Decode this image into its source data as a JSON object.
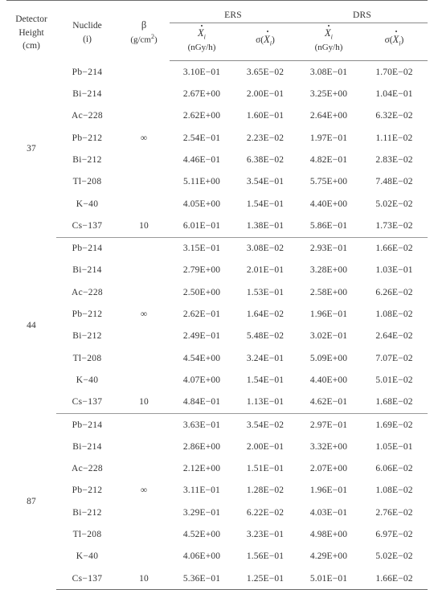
{
  "table": {
    "headers": {
      "detector_height": [
        "Detector",
        "Height",
        "(cm)"
      ],
      "nuclide": [
        "Nuclide",
        "(i)"
      ],
      "group_ers": "ERS",
      "group_drs": "DRS",
      "beta_symbol": "β",
      "beta_unit": "(g/cm",
      "beta_unit_sup": "2",
      "beta_unit_close": ")",
      "dose_symbol": "X",
      "dose_sub": "i",
      "dose_unit": "(nGy/h)",
      "sigma_open": "σ(",
      "sigma_symbol": "X",
      "sigma_sub": "i",
      "sigma_close": ")"
    },
    "columns": [
      "Detector Height (cm)",
      "Nuclide (i)",
      "β (g/cm2)",
      "ERS Ẋi (nGy/h)",
      "ERS σ(Ẋi)",
      "DRS Ẋi (nGy/h)",
      "DRS σ(Ẋi)"
    ],
    "blocks": [
      {
        "detector_height": "37",
        "rows": [
          {
            "nuclide": "Pb−214",
            "beta": "",
            "ers_x": "3.10E−01",
            "ers_sigma": "3.65E−02",
            "drs_x": "3.08E−01",
            "drs_sigma": "1.70E−02"
          },
          {
            "nuclide": "Bi−214",
            "beta": "",
            "ers_x": "2.67E+00",
            "ers_sigma": "2.00E−01",
            "drs_x": "3.25E+00",
            "drs_sigma": "1.04E−01"
          },
          {
            "nuclide": "Ac−228",
            "beta": "",
            "ers_x": "2.62E+00",
            "ers_sigma": "1.60E−01",
            "drs_x": "2.64E+00",
            "drs_sigma": "6.32E−02"
          },
          {
            "nuclide": "Pb−212",
            "beta": "∞",
            "ers_x": "2.54E−01",
            "ers_sigma": "2.23E−02",
            "drs_x": "1.97E−01",
            "drs_sigma": "1.11E−02"
          },
          {
            "nuclide": "Bi−212",
            "beta": "",
            "ers_x": "4.46E−01",
            "ers_sigma": "6.38E−02",
            "drs_x": "4.82E−01",
            "drs_sigma": "2.83E−02"
          },
          {
            "nuclide": "Tl−208",
            "beta": "",
            "ers_x": "5.11E+00",
            "ers_sigma": "3.54E−01",
            "drs_x": "5.75E+00",
            "drs_sigma": "7.48E−02"
          },
          {
            "nuclide": "K−40",
            "beta": "",
            "ers_x": "4.05E+00",
            "ers_sigma": "1.54E−01",
            "drs_x": "4.40E+00",
            "drs_sigma": "5.02E−02"
          },
          {
            "nuclide": "Cs−137",
            "beta": "10",
            "ers_x": "6.01E−01",
            "ers_sigma": "1.38E−01",
            "drs_x": "5.86E−01",
            "drs_sigma": "1.73E−02"
          }
        ]
      },
      {
        "detector_height": "44",
        "rows": [
          {
            "nuclide": "Pb−214",
            "beta": "",
            "ers_x": "3.15E−01",
            "ers_sigma": "3.08E−02",
            "drs_x": "2.93E−01",
            "drs_sigma": "1.66E−02"
          },
          {
            "nuclide": "Bi−214",
            "beta": "",
            "ers_x": "2.79E+00",
            "ers_sigma": "2.01E−01",
            "drs_x": "3.28E+00",
            "drs_sigma": "1.03E−01"
          },
          {
            "nuclide": "Ac−228",
            "beta": "",
            "ers_x": "2.50E+00",
            "ers_sigma": "1.53E−01",
            "drs_x": "2.58E+00",
            "drs_sigma": "6.26E−02"
          },
          {
            "nuclide": "Pb−212",
            "beta": "∞",
            "ers_x": "2.62E−01",
            "ers_sigma": "1.64E−02",
            "drs_x": "1.96E−01",
            "drs_sigma": "1.08E−02"
          },
          {
            "nuclide": "Bi−212",
            "beta": "",
            "ers_x": "2.49E−01",
            "ers_sigma": "5.48E−02",
            "drs_x": "3.02E−01",
            "drs_sigma": "2.64E−02"
          },
          {
            "nuclide": "Tl−208",
            "beta": "",
            "ers_x": "4.54E+00",
            "ers_sigma": "3.24E−01",
            "drs_x": "5.09E+00",
            "drs_sigma": "7.07E−02"
          },
          {
            "nuclide": "K−40",
            "beta": "",
            "ers_x": "4.07E+00",
            "ers_sigma": "1.54E−01",
            "drs_x": "4.40E+00",
            "drs_sigma": "5.01E−02"
          },
          {
            "nuclide": "Cs−137",
            "beta": "10",
            "ers_x": "4.84E−01",
            "ers_sigma": "1.13E−01",
            "drs_x": "4.62E−01",
            "drs_sigma": "1.68E−02"
          }
        ]
      },
      {
        "detector_height": "87",
        "rows": [
          {
            "nuclide": "Pb−214",
            "beta": "",
            "ers_x": "3.63E−01",
            "ers_sigma": "3.54E−02",
            "drs_x": "2.97E−01",
            "drs_sigma": "1.69E−02"
          },
          {
            "nuclide": "Bi−214",
            "beta": "",
            "ers_x": "2.86E+00",
            "ers_sigma": "2.00E−01",
            "drs_x": "3.32E+00",
            "drs_sigma": "1.05E−01"
          },
          {
            "nuclide": "Ac−228",
            "beta": "",
            "ers_x": "2.12E+00",
            "ers_sigma": "1.51E−01",
            "drs_x": "2.07E+00",
            "drs_sigma": "6.06E−02"
          },
          {
            "nuclide": "Pb−212",
            "beta": "∞",
            "ers_x": "3.11E−01",
            "ers_sigma": "1.28E−02",
            "drs_x": "1.96E−01",
            "drs_sigma": "1.08E−02"
          },
          {
            "nuclide": "Bi−212",
            "beta": "",
            "ers_x": "3.29E−01",
            "ers_sigma": "6.22E−02",
            "drs_x": "4.03E−01",
            "drs_sigma": "2.76E−02"
          },
          {
            "nuclide": "Tl−208",
            "beta": "",
            "ers_x": "4.52E+00",
            "ers_sigma": "3.23E−01",
            "drs_x": "4.98E+00",
            "drs_sigma": "6.97E−02"
          },
          {
            "nuclide": "K−40",
            "beta": "",
            "ers_x": "4.06E+00",
            "ers_sigma": "1.56E−01",
            "drs_x": "4.29E+00",
            "drs_sigma": "5.02E−02"
          },
          {
            "nuclide": "Cs−137",
            "beta": "10",
            "ers_x": "5.36E−01",
            "ers_sigma": "1.25E−01",
            "drs_x": "5.01E−01",
            "drs_sigma": "1.66E−02"
          }
        ]
      }
    ]
  }
}
